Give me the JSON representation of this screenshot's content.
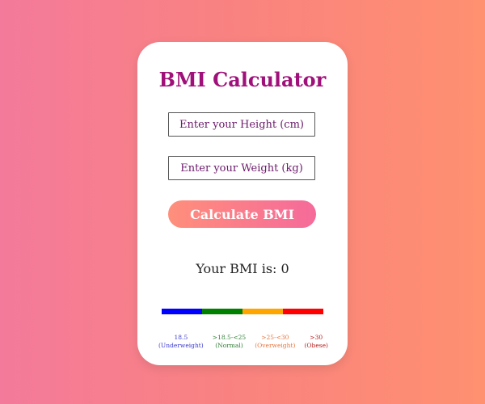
{
  "app": {
    "title": "BMI Calculator"
  },
  "inputs": {
    "height_placeholder": "Enter your Height (cm)",
    "height_value": "",
    "weight_placeholder": "Enter your Weight (kg)",
    "weight_value": ""
  },
  "calculate_button": {
    "label": "Calculate BMI"
  },
  "result": {
    "text": "Your BMI is: 0"
  },
  "bmi_scale": {
    "segments": [
      {
        "range": "18.5",
        "category": "(Underweight)",
        "color": "#0000ff"
      },
      {
        "range": ">18.5-<25",
        "category": "(Normal)",
        "color": "#008000"
      },
      {
        "range": ">25-<30",
        "category": "(Overweight)",
        "color": "#ffa500"
      },
      {
        "range": ">30",
        "category": "(Obese)",
        "color": "#ff0000"
      }
    ],
    "label_colors": [
      "#3a3acf",
      "#2e7d32",
      "#e8743b",
      "#b71c1c"
    ]
  },
  "colors": {
    "title": "#a0107a",
    "input_text": "#6b1a6b",
    "button_gradient_start": "#ff8f7b",
    "button_gradient_end": "#f56a9b",
    "background_gradient_start": "#f47a9b",
    "background_gradient_end": "#ff9070"
  }
}
